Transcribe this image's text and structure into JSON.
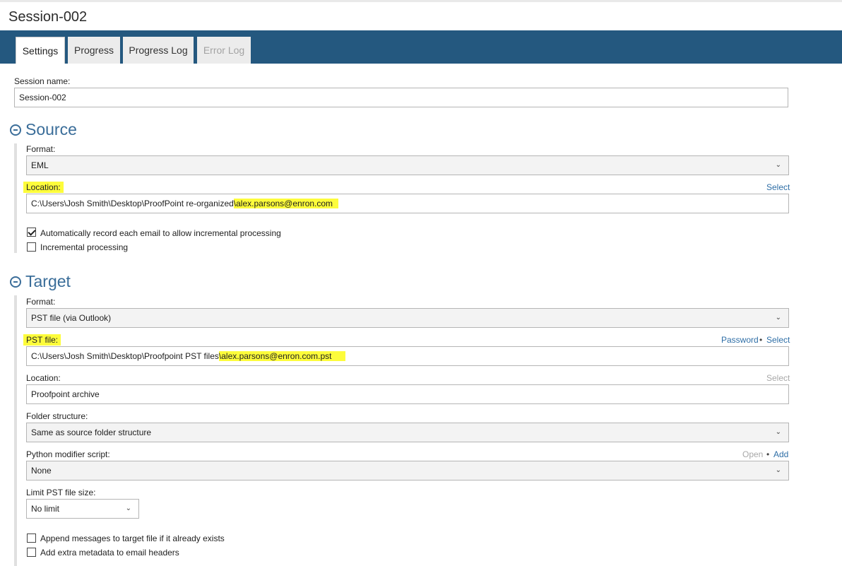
{
  "window": {
    "title": "Session-002"
  },
  "tabs": [
    {
      "label": "Settings"
    },
    {
      "label": "Progress"
    },
    {
      "label": "Progress Log"
    },
    {
      "label": "Error Log"
    }
  ],
  "session": {
    "label": "Session name:",
    "value": "Session-002"
  },
  "source": {
    "heading": "Source",
    "format": {
      "label": "Format:",
      "value": "EML"
    },
    "location": {
      "label": "Location:",
      "select": "Select",
      "value_prefix": "C:\\Users\\Josh Smith\\Desktop\\ProofPoint re-organized",
      "value_highlight": "\\alex.parsons@enron.com"
    },
    "auto_record": {
      "label": "Automatically record each email to allow incremental processing",
      "checked": true
    },
    "incremental": {
      "label": "Incremental processing",
      "checked": false
    }
  },
  "target": {
    "heading": "Target",
    "format": {
      "label": "Format:",
      "value": "PST file (via Outlook)"
    },
    "pst_file": {
      "label": "PST file:",
      "password": "Password",
      "separator": "•",
      "select": "Select",
      "value_prefix": "C:\\Users\\Josh Smith\\Desktop\\Proofpoint PST files",
      "value_highlight": "\\alex.parsons@enron.com.pst"
    },
    "location": {
      "label": "Location:",
      "select": "Select",
      "value": "Proofpoint archive"
    },
    "folder_structure": {
      "label": "Folder structure:",
      "value": "Same as source folder structure"
    },
    "python_script": {
      "label": "Python modifier script:",
      "open": "Open",
      "separator": "•",
      "add": "Add",
      "value": "None"
    },
    "limit_size": {
      "label": "Limit PST file size:",
      "value": "No limit"
    },
    "append": {
      "label": "Append messages to target file if it already exists",
      "checked": false
    },
    "extra_metadata": {
      "label": "Add extra metadata to email headers",
      "checked": false
    }
  },
  "colors": {
    "accent": "#24587f",
    "heading": "#3a6d99",
    "link": "#2e6ea6",
    "highlight": "#fdfc3b"
  }
}
